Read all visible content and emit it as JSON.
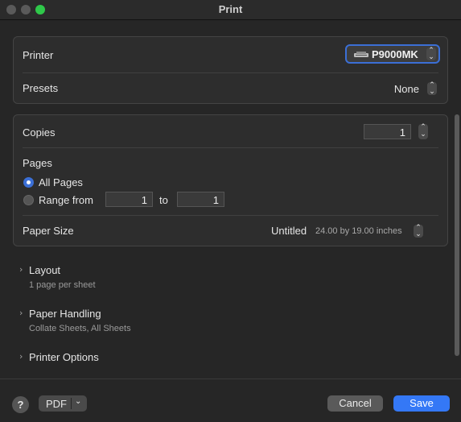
{
  "window": {
    "title": "Print"
  },
  "printer_group": {
    "printer_label": "Printer",
    "printer_value": "P9000MK",
    "presets_label": "Presets",
    "presets_value": "None"
  },
  "copies_group": {
    "copies_label": "Copies",
    "copies_value": "1",
    "pages_label": "Pages",
    "all_pages_label": "All Pages",
    "range_label": "Range from",
    "range_from": "1",
    "range_to_label": "to",
    "range_to": "1",
    "paper_size_label": "Paper Size",
    "paper_size_value": "Untitled",
    "paper_size_dims": "24.00 by 19.00 inches"
  },
  "sections": [
    {
      "title": "Layout",
      "subtitle": "1 page per sheet"
    },
    {
      "title": "Paper Handling",
      "subtitle": "Collate Sheets, All Sheets"
    },
    {
      "title": "Printer Options",
      "subtitle": ""
    }
  ],
  "footer": {
    "help_label": "?",
    "pdf_label": "PDF",
    "cancel_label": "Cancel",
    "save_label": "Save"
  },
  "icons": {
    "printer": "printer-icon",
    "stepper": "up-down-chevron-icon",
    "disclosure": "chevron-right-icon"
  },
  "colors": {
    "accent": "#3478f6",
    "focus_ring": "#3b6fd6",
    "zoom_button": "#2fc84a"
  }
}
